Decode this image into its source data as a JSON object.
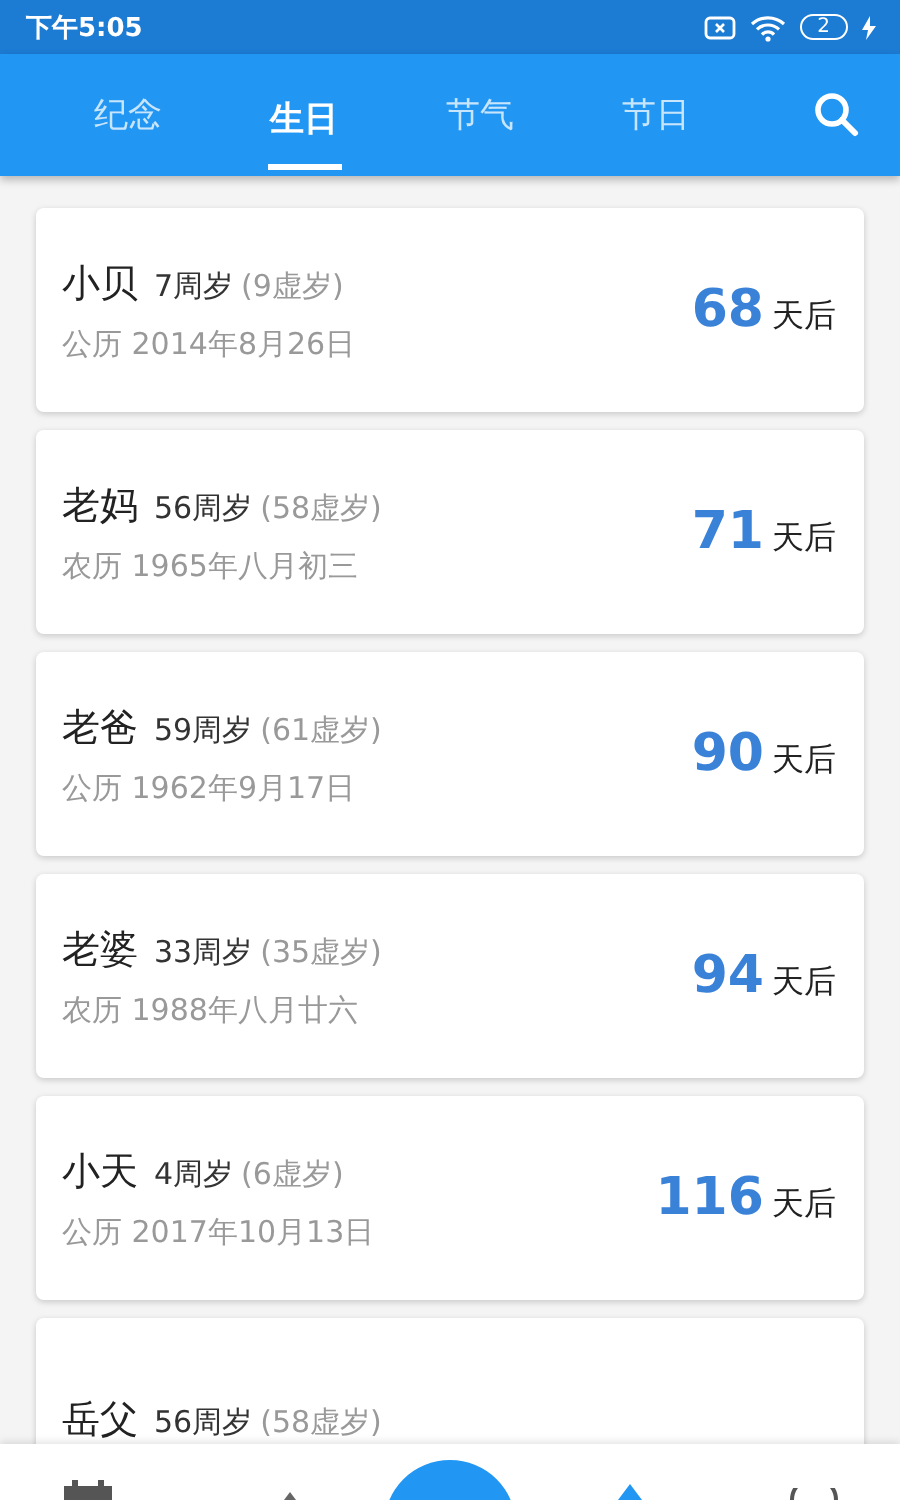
{
  "status_bar": {
    "time": "下午5:05",
    "sim_badge": "2"
  },
  "tabs": [
    {
      "label": "纪念",
      "selected": false
    },
    {
      "label": "生日",
      "selected": true
    },
    {
      "label": "节气",
      "selected": false
    },
    {
      "label": "节日",
      "selected": false
    }
  ],
  "birthdays": [
    {
      "name": "小贝",
      "age": "7周岁",
      "lunar_age": "(9虚岁)",
      "date": "公历 2014年8月26日",
      "days": "68",
      "unit": "天后"
    },
    {
      "name": "老妈",
      "age": "56周岁",
      "lunar_age": "(58虚岁)",
      "date": "农历 1965年八月初三",
      "days": "71",
      "unit": "天后"
    },
    {
      "name": "老爸",
      "age": "59周岁",
      "lunar_age": "(61虚岁)",
      "date": "公历 1962年9月17日",
      "days": "90",
      "unit": "天后"
    },
    {
      "name": "老婆",
      "age": "33周岁",
      "lunar_age": "(35虚岁)",
      "date": "农历 1988年八月廿六",
      "days": "94",
      "unit": "天后"
    },
    {
      "name": "小天",
      "age": "4周岁",
      "lunar_age": "(6虚岁)",
      "date": "公历 2017年10月13日",
      "days": "116",
      "unit": "天后"
    },
    {
      "name": "岳父",
      "age": "56周岁",
      "lunar_age": "(58虚岁)"
    }
  ]
}
